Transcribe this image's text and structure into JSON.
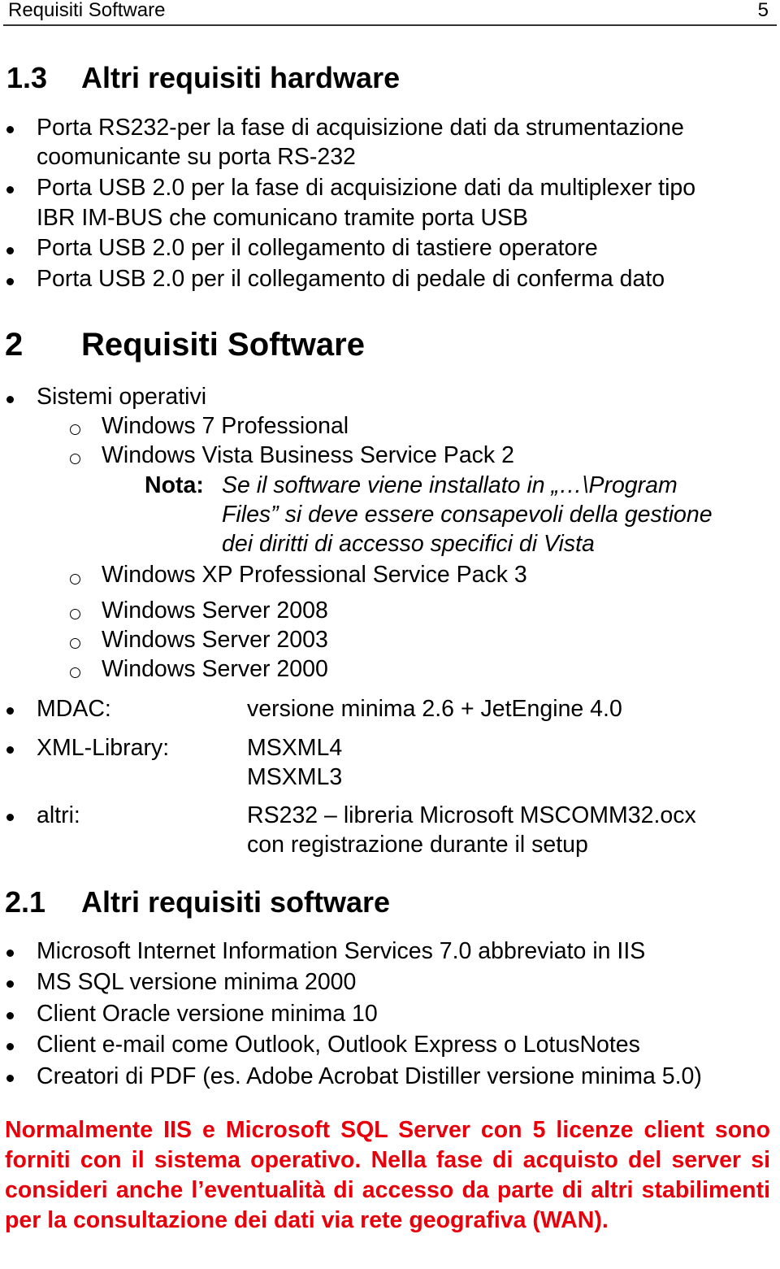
{
  "header": {
    "title": "Requisiti Software",
    "page_number": "5"
  },
  "section_1_3": {
    "number": "1.3",
    "title": "Altri requisiti hardware",
    "items": [
      {
        "line1": "Porta RS232-per la fase di acquisizione dati da strumentazione",
        "line2": "coomunicante su porta RS-232"
      },
      {
        "line1": "Porta USB 2.0 per la fase di acquisizione dati da multiplexer tipo",
        "line2": "IBR IM-BUS che comunicano tramite porta USB"
      },
      {
        "line1": "Porta USB 2.0 per il collegamento di tastiere operatore"
      },
      {
        "line1": "Porta USB 2.0 per il collegamento di pedale di conferma dato"
      }
    ]
  },
  "section_2": {
    "number": "2",
    "title": "Requisiti Software",
    "os_label": "Sistemi operativi",
    "os_items": [
      "Windows 7 Professional",
      "Windows Vista Business Service Pack 2",
      "Windows XP Professional Service Pack 3",
      "Windows Server 2008",
      "Windows Server 2003",
      "Windows Server 2000"
    ],
    "note": {
      "label": "Nota:",
      "lines": [
        "Se il software viene installato in „…\\Program",
        "Files” si deve essere consapevoli della gestione",
        "dei diritti di accesso specifici di Vista"
      ]
    },
    "requirements": [
      {
        "label": "MDAC:",
        "values": [
          "versione minima 2.6 + JetEngine 4.0"
        ]
      },
      {
        "label": "XML-Library:",
        "values": [
          "MSXML4",
          "MSXML3"
        ]
      },
      {
        "label": "altri:",
        "values": [
          "RS232 – libreria Microsoft MSCOMM32.ocx",
          "con registrazione durante il setup"
        ]
      }
    ]
  },
  "section_2_1": {
    "number": "2.1",
    "title": "Altri requisiti software",
    "items": [
      "Microsoft Internet Information Services 7.0 abbreviato in IIS",
      "MS SQL versione minima 2000",
      "Client Oracle versione minima 10",
      "Client e-mail come Outlook, Outlook Express o LotusNotes",
      "Creatori di PDF (es. Adobe Acrobat Distiller versione minima 5.0)"
    ]
  },
  "warning": {
    "color": "#e8000b",
    "text": "Normalmente IIS e Microsoft SQL Server con 5 licenze client sono forniti con il sistema operativo. Nella fase di acquisto del server si consideri anche l’eventualità di accesso da parte di altri stabilimenti per la consultazione dei dati via rete geografiva (WAN)."
  }
}
